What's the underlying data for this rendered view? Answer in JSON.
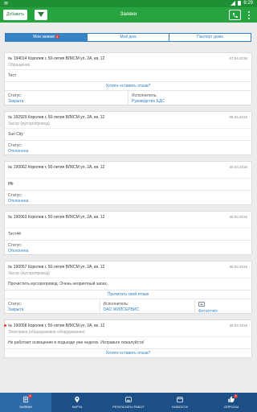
{
  "status_bar": {
    "left_icon": "mail-icon",
    "time": "6:29"
  },
  "header": {
    "add_label": "Добавить",
    "title": "Заявки"
  },
  "tabs": [
    {
      "label": "Мои заявки",
      "badge": "4",
      "active": true
    },
    {
      "label": "Мой дом",
      "active": false
    },
    {
      "label": "Паспорт дома",
      "active": false
    }
  ],
  "requests": [
    {
      "title": "№ 194014 Королев г, 50-летия ВЛКСМ ул, 2А, кв. 12",
      "date": "07.04.2016",
      "category": "Обращение",
      "text": "Тест",
      "link": "Хотите оставить отзыв?",
      "status_label": "Статус:",
      "status": "Закрыта",
      "executor_label": "Исполнитель:",
      "executor": "Руководство ЕДС"
    },
    {
      "title": "№ 192929 Королев г, 50-летия ВЛКСМ ул, 2А, кв. 12",
      "date": "05.04.2016",
      "category": "Засор (мусоропровод)",
      "text": "Sun City",
      "status_label": "Статус:",
      "status": "Отклонена"
    },
    {
      "title": "№ 190062 Королев г, 50-летия ВЛКСМ ул, 2А, кв. 12",
      "date": "30.03.2016",
      "category": "",
      "text": "ffffr",
      "status_label": "Статус:",
      "status": "Отклонена"
    },
    {
      "title": "№ 190063 Королев г, 50-летия ВЛКСМ ул, 2А, кв. 12",
      "date": "30.03.2016",
      "category": "",
      "text": "Тест44",
      "status_label": "Статус:",
      "status": "Отклонена"
    },
    {
      "title": "№ 190057 Королев г, 50-летия ВЛКСМ ул, 2А, кв. 12",
      "date": "30.03.2016",
      "category": "Засор (мусоропровод)",
      "text": "Прочистить мусоропровод. Очень неприятный запах.",
      "link": "Прочитать свой отзыв",
      "status_label": "Статус:",
      "status": "Закрыта",
      "executor_label": "Исполнитель:",
      "executor": "ОАО ЖИЛСЕРВИС",
      "photo_label": "Фотоотчёт"
    },
    {
      "title": "№ 190058 Королев г, 50-летия ВЛКСМ ул, 2А, кв. 12",
      "date": "30.03.2016",
      "category": "Электрика (общедомовое оборудование)",
      "text": "Не работает освещение в подъезде уже неделю. Исправьте пожалуйста!",
      "link": "Хотите оставить отзыв?"
    }
  ],
  "bottom_nav": [
    {
      "label": "ЗАЯВКИ",
      "icon": "requests-icon",
      "badge": "4",
      "active": true
    },
    {
      "label": "КАРТА",
      "icon": "map-pin-icon",
      "active": false
    },
    {
      "label": "РЕЗУЛЬТАТЫ РАБОТ",
      "icon": "image-icon",
      "active": false
    },
    {
      "label": "НОВОСТИ",
      "icon": "calendar-icon",
      "active": false
    },
    {
      "label": "ОПРОСЫ",
      "icon": "thumbs-up-icon",
      "badge": "2",
      "active": false
    }
  ],
  "colors": {
    "header_green": "#27a33f",
    "status_green": "#1f8f35",
    "link_blue": "#2f7fc4",
    "nav_blue": "#1b4f86",
    "badge_red": "#e53935"
  }
}
